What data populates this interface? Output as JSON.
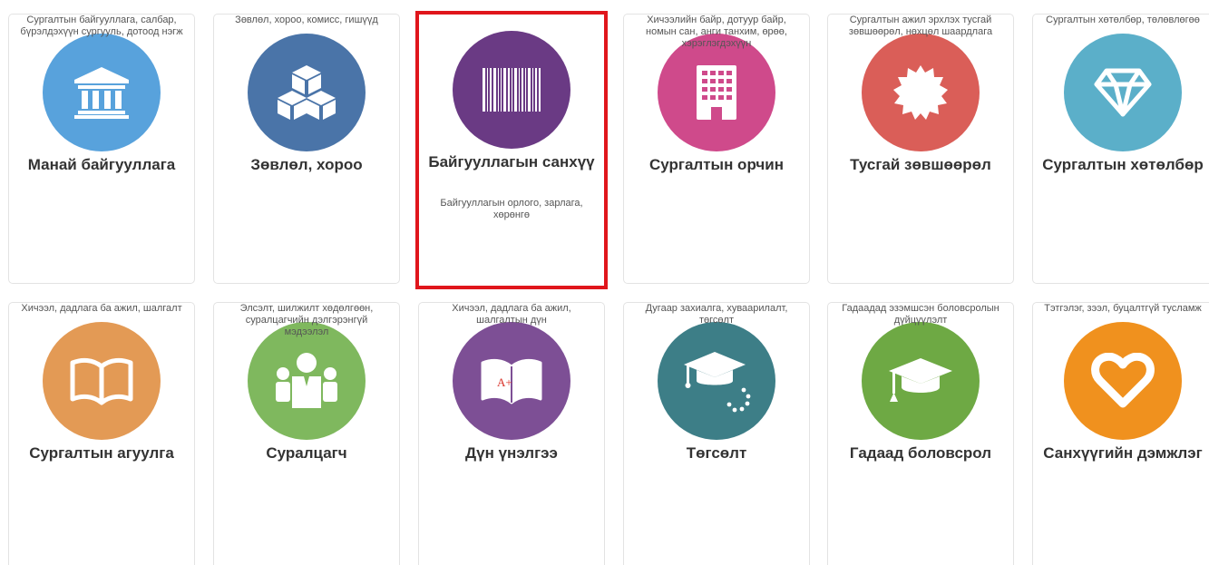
{
  "colors": {
    "card_border": "#e3e3e3",
    "selected_border": "#e0161c",
    "title_text": "#333333",
    "desc_text": "#555555"
  },
  "cards": [
    {
      "title": "Манай байгууллага",
      "description": "Сургалтын байгууллага, салбар, бүрэлдэхүүн сургууль, дотоод нэгж",
      "icon": "institution-icon",
      "color": "#58a2dc",
      "selected": false
    },
    {
      "title": "Зөвлөл, хороо",
      "description": "Зөвлөл, хороо, комисс, гишүүд",
      "icon": "cubes-icon",
      "color": "#4a74a8",
      "selected": false
    },
    {
      "title": "Байгууллагын санхүү",
      "description": "Байгууллагын орлого, зарлага, хөрөнгө",
      "icon": "barcode-icon",
      "color": "#6a3a84",
      "selected": true
    },
    {
      "title": "Сургалтын орчин",
      "description": "Хичээлийн байр, дотуур байр, номын сан, анги танхим, өрөө, хэрэглэгдэхүүн",
      "icon": "building-icon",
      "color": "#cf4a8b",
      "selected": false
    },
    {
      "title": "Тусгай зөвшөөрөл",
      "description": "Сургалтын ажил эрхлэх тусгай зөвшөөрөл, нөхцөл шаардлага",
      "icon": "certificate-icon",
      "color": "#da5e58",
      "selected": false
    },
    {
      "title": "Сургалтын хөтөлбөр",
      "description": "Сургалтын хөтөлбөр, төлөвлөгөө",
      "icon": "diamond-icon",
      "color": "#5bafc9",
      "selected": false
    },
    {
      "title": "Сургалтын агуулга",
      "description": "Хичээл, дадлага ба ажил, шалгалт",
      "icon": "open-book-icon",
      "color": "#e39a55",
      "selected": false
    },
    {
      "title": "Суралцагч",
      "description": "Элсэлт, шилжилт хөдөлгөөн, суралцагчийн дэлгэрэнгүй мэдээлэл",
      "icon": "students-icon",
      "color": "#7fb85e",
      "selected": false
    },
    {
      "title": "Дүн үнэлгээ",
      "description": "Хичээл, дадлага ба ажил, шалгалтын дүн",
      "icon": "graded-book-icon",
      "color": "#7d4f95",
      "selected": false
    },
    {
      "title": "Төгсөлт",
      "description": "Дугаар захиалга, хуваарилалт, төгсөлт",
      "icon": "graduation-cap-loading-icon",
      "color": "#3d7e87",
      "selected": false
    },
    {
      "title": "Гадаад боловсрол",
      "description": "Гадаадад эзэмшсэн боловсролын дүйцүүлэлт",
      "icon": "graduation-cap-icon",
      "color": "#6ea944",
      "selected": false
    },
    {
      "title": "Санхүүгийн дэмжлэг",
      "description": "Тэтгэлэг, зээл, буцалтгүй тусламж",
      "icon": "heart-icon",
      "color": "#f0911e",
      "selected": false
    }
  ]
}
